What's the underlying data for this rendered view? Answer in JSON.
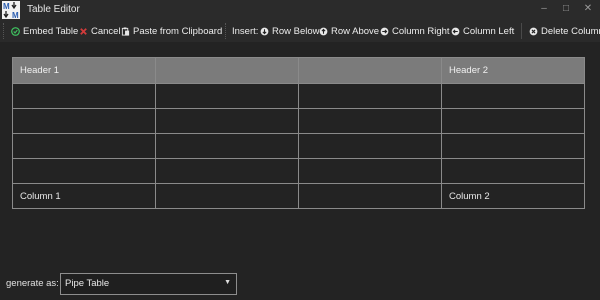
{
  "window": {
    "title": "Table Editor",
    "controls": [
      "–",
      "□",
      "✕"
    ]
  },
  "toolbar": {
    "embed_label": "Embed Table",
    "cancel_label": "Cancel",
    "paste_label": "Paste from Clipboard",
    "insert_label": "Insert:",
    "row_below_label": "Row Below",
    "row_above_label": "Row Above",
    "col_right_label": "Column Right",
    "col_left_label": "Column Left",
    "delete_label": "Delete Column",
    "icons": {
      "embed": "embed-icon",
      "cancel": "cancel-x-icon",
      "paste": "clipboard-icon",
      "insert": "circle-arrow-icon",
      "delete": "circle-x-icon"
    }
  },
  "table": {
    "rows": [
      [
        "Header 1",
        "",
        "",
        "Header 2"
      ],
      [
        "",
        "",
        "",
        ""
      ],
      [
        "",
        "",
        "",
        ""
      ],
      [
        "",
        "",
        "",
        ""
      ],
      [
        "",
        "",
        "",
        ""
      ],
      [
        "Column 1",
        "",
        "",
        "Column 2"
      ]
    ]
  },
  "generate": {
    "label": "generate as:",
    "selected": "Pipe Table"
  },
  "colors": {
    "background": "#232323",
    "header_fill": "#7b7b7b",
    "embed_icon": "#3fbf5f",
    "cancel_icon": "#d23b3b",
    "grid_lines": "#8a8a8a"
  }
}
